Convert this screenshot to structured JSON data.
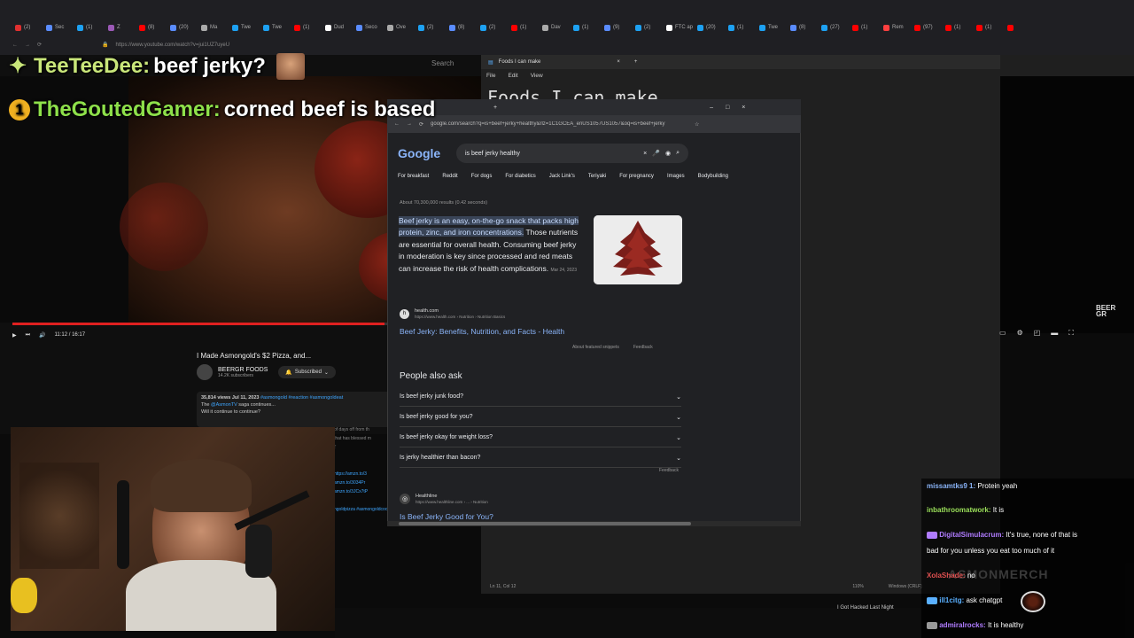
{
  "browser": {
    "tabs": [
      "(2)",
      "Sec",
      "(1)",
      "Z",
      "(8)",
      "(20)",
      "Ma",
      "Twe",
      "Twe",
      "(1)",
      "Dud",
      "Seco",
      "Ove",
      "(2)",
      "(8)",
      "(2)",
      "(1)",
      "Dav",
      "(1)",
      "(9)",
      "(2)",
      "FTC app",
      "(20)",
      "(1)",
      "Twe",
      "(8)",
      "(27)",
      "(1)",
      "Rem",
      "(97)",
      "(1)",
      "(1)",
      ""
    ],
    "url": "https://www.youtube.com/watch?v=jui1UZ7uyeU"
  },
  "overlay_chat": [
    {
      "user": "TeeTeeDee:",
      "message": "beef jerky?",
      "badge": "✦"
    },
    {
      "user": "TheGoutedGamer:",
      "message": "corned beef is based",
      "badge": "1"
    }
  ],
  "youtube": {
    "search_label": "Search",
    "time": "11:12 / 16:17",
    "title": "I Made Asmongold's $2 Pizza, and...",
    "channel": "BEERGR FOODS",
    "subs": "14.2K subscribers",
    "subscribed": "Subscribed",
    "views": "35,814 views Jul 11, 2023",
    "desc_tags": "#asmongold #reaction #asmongoldeat",
    "desc_line1": "The",
    "desc_mention": "@AsmonTV",
    "desc_line1b": "saga continues...",
    "desc_line2": "Will it continue to continue?",
    "side_text": [
      "of days off from th",
      "that has blessed m",
      "t'"
    ],
    "side_links": [
      "https://amzn.to/3",
      "amzn.to/3034Pr",
      "amzn.to/3JCx7tP",
      "ngoldpizza #asmongoldcooking"
    ],
    "gr_logo": "BEER\nGR"
  },
  "notepad": {
    "tab": "Foods I can make",
    "menu": [
      "File",
      "Edit",
      "View"
    ],
    "content": "Foods I can make",
    "status_pos": "Ln 11, Col 12",
    "status_zoom": "110%",
    "status_enc": "Windows (CRLF)"
  },
  "google": {
    "address": "google.com/search?q=is+beef+jerky+healthy&rlz=1C1GCEA_enUS1057US1057&oq=is+beef+jerky",
    "logo": "Google",
    "query": "is beef jerky healthy",
    "chips": [
      "For breakfast",
      "Reddit",
      "For dogs",
      "For diabetics",
      "Jack Link's",
      "Teriyaki",
      "For pregnancy",
      "Images",
      "Bodybuilding"
    ],
    "results_count": "About 70,300,000 results (0.42 seconds)",
    "snippet_highlight": "Beef jerky is an easy, on-the-go snack that packs high protein, zinc, and iron concentrations.",
    "snippet_rest": " Those nutrients are essential for overall health. Consuming beef jerky in moderation is key since processed and red meats can increase the risk of health complications.",
    "snippet_date": "Mar 24, 2023",
    "source_name": "health.com",
    "source_path": "https://www.health.com › Nutrition › Nutrition Basics",
    "source_link": "Beef Jerky: Benefits, Nutrition, and Facts - Health",
    "about_snippets": "About featured snippets",
    "feedback": "Feedback",
    "paa_title": "People also ask",
    "paa": [
      "Is beef jerky junk food?",
      "Is beef jerky good for you?",
      "Is beef jerky okay for weight loss?",
      "Is jerky healthier than bacon?"
    ],
    "res2_name": "Healthline",
    "res2_path": "https://www.healthline.com › ... › Nutrition",
    "res2_link": "Is Beef Jerky Good for You?"
  },
  "twitch_chat": [
    {
      "user": "missamtks9 1:",
      "msg": "Protein yeah",
      "color": "#8ab4f8"
    },
    {
      "user": "inbathroomatwork:",
      "msg": "It is",
      "color": "#9be05a"
    },
    {
      "user": "DigitalSimulacrum:",
      "msg": "It's true, none of that is",
      "color": "#b07cff"
    },
    {
      "user": "",
      "msg": "bad for you unless you eat too much of it",
      "color": "#fff"
    },
    {
      "user": "XolaShade:",
      "msg": "no",
      "color": "#e05050"
    },
    {
      "user": "ill1citg:",
      "msg": "ask chatgpt",
      "color": "#5ab0ff"
    },
    {
      "user": "admiralrocks:",
      "msg": "It is healthy",
      "color": "#b07cff"
    }
  ],
  "merch_watermark": "ASMONMERCH",
  "bottom_text": "I Got Hacked Last Night"
}
